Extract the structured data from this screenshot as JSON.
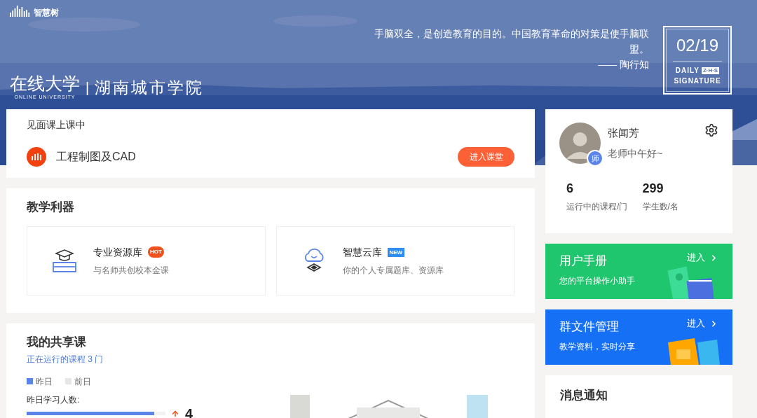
{
  "header": {
    "logo_text": "智慧树",
    "brand": "在线大学",
    "brand_sub": "ONLINE UNIVERSITY",
    "separator": "|",
    "school": "湖南城市学院",
    "quote": "手脑双全，是创造教育的目的。中国教育革命的对策是使手脑联盟。",
    "quote_author": "—— 陶行知",
    "date": "02/19",
    "signature_line1": "DAILY",
    "signature_badge": "Z·H·S",
    "signature_line2": "SIGNATURE"
  },
  "live_class": {
    "title": "见面课上课中",
    "course": "工程制图及CAD",
    "button": "进入课堂"
  },
  "tools": {
    "title": "教学利器",
    "items": [
      {
        "kind": "library",
        "name": "专业资源库",
        "badge": "HOT",
        "desc": "与名师共创校本金课"
      },
      {
        "kind": "cloud",
        "name": "智慧云库",
        "badge": "NEW",
        "desc": "你的个人专属题库、资源库"
      }
    ]
  },
  "shared": {
    "title": "我的共享课",
    "subtitle": "正在运行的课程 3 门",
    "legend": [
      {
        "label": "昨日",
        "color": "#5b84e8"
      },
      {
        "label": "前日",
        "color": "#e6e6e6"
      }
    ],
    "stat_label": "昨日学习人数:",
    "bar": {
      "level": 0.92
    },
    "value": "4"
  },
  "profile": {
    "name": "张闻芳",
    "greeting": "老师中午好~",
    "role_badge": "师",
    "stats": [
      {
        "value": "6",
        "label": "运行中的课程/门"
      },
      {
        "value": "299",
        "label": "学生数/名"
      }
    ]
  },
  "promos": [
    {
      "kind": "manual",
      "title": "用户手册",
      "desc": "您的平台操作小助手",
      "link": "进入"
    },
    {
      "kind": "files",
      "title": "群文件管理",
      "desc": "教学资料，实时分享",
      "link": "进入"
    }
  ],
  "notices": {
    "title": "消息通知"
  }
}
